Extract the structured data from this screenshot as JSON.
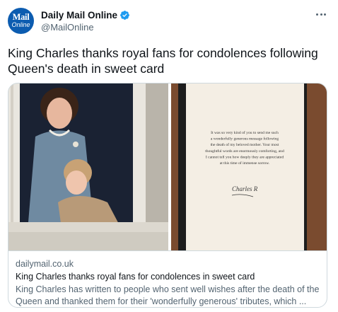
{
  "account": {
    "display_name": "Daily Mail Online",
    "handle": "@MailOnline",
    "avatar_logo_top": "Mail",
    "avatar_logo_bottom": "Online",
    "verified_color": "#1d9bf0",
    "avatar_color": "#0c5cb0",
    "verified_icon": "verified-badge-icon"
  },
  "tweet": {
    "text": "King Charles thanks royal fans for condolences following Queen's death in sweet card",
    "more_icon": "ellipsis-icon"
  },
  "link_card": {
    "domain": "dailymail.co.uk",
    "title": "King Charles thanks royal fans for condolences in sweet card",
    "description": "King Charles has written to people who sent well wishes after the death of the Queen and thanked them for their 'wonderfully generous' tributes, which ...",
    "image_letter_lines": [
      "It was so very kind of you to send me such",
      "a wonderfully generous message following",
      "the death of my beloved mother. Your most",
      "thoughtful words are enormously comforting, and",
      "I cannot tell you how deeply they are appreciated",
      "at this time of immense sorrow."
    ],
    "image_signature": "Charles R"
  }
}
